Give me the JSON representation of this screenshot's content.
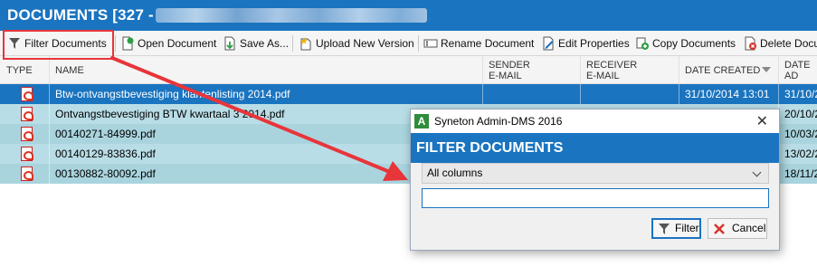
{
  "window": {
    "title": "DOCUMENTS [327 -"
  },
  "toolbar": {
    "filter_documents": "Filter Documents",
    "open_document": "Open Document",
    "save_as": "Save As...",
    "upload_new_version": "Upload New Version",
    "rename_document": "Rename Document",
    "edit_properties": "Edit Properties",
    "copy_documents": "Copy Documents",
    "delete_documents": "Delete Docu"
  },
  "grid": {
    "columns": {
      "type": "TYPE",
      "name": "NAME",
      "sender_email": "SENDER\nE-MAIL",
      "receiver_email": "RECEIVER\nE-MAIL",
      "date_created": "DATE CREATED",
      "date_a": "DATE AD"
    },
    "rows": [
      {
        "name": "Btw-ontvangstbevestiging klantenlisting 2014.pdf",
        "date_created": "31/10/2014 13:01",
        "date_a": "31/10/2",
        "selected": true
      },
      {
        "name": "Ontvangstbevestiging BTW kwartaal 3 2014.pdf",
        "date_created": "",
        "date_a": "20/10/2",
        "selected": false
      },
      {
        "name": "00140271-84999.pdf",
        "date_created": "",
        "date_a": "10/03/2",
        "selected": false
      },
      {
        "name": "00140129-83836.pdf",
        "date_created": "",
        "date_a": "13/02/2",
        "selected": false
      },
      {
        "name": "00130882-80092.pdf",
        "date_created": "",
        "date_a": "18/11/2",
        "selected": false
      }
    ]
  },
  "dialog": {
    "window_title": "Syneton Admin-DMS 2016",
    "heading": "FILTER DOCUMENTS",
    "column_select": "All columns",
    "filter_value": "",
    "filter_button": "Filter",
    "cancel_button": "Cancel"
  },
  "colors": {
    "accent": "#1a74c0",
    "row_highlight": "#b9dde6",
    "annotation_red": "#e8353a"
  }
}
